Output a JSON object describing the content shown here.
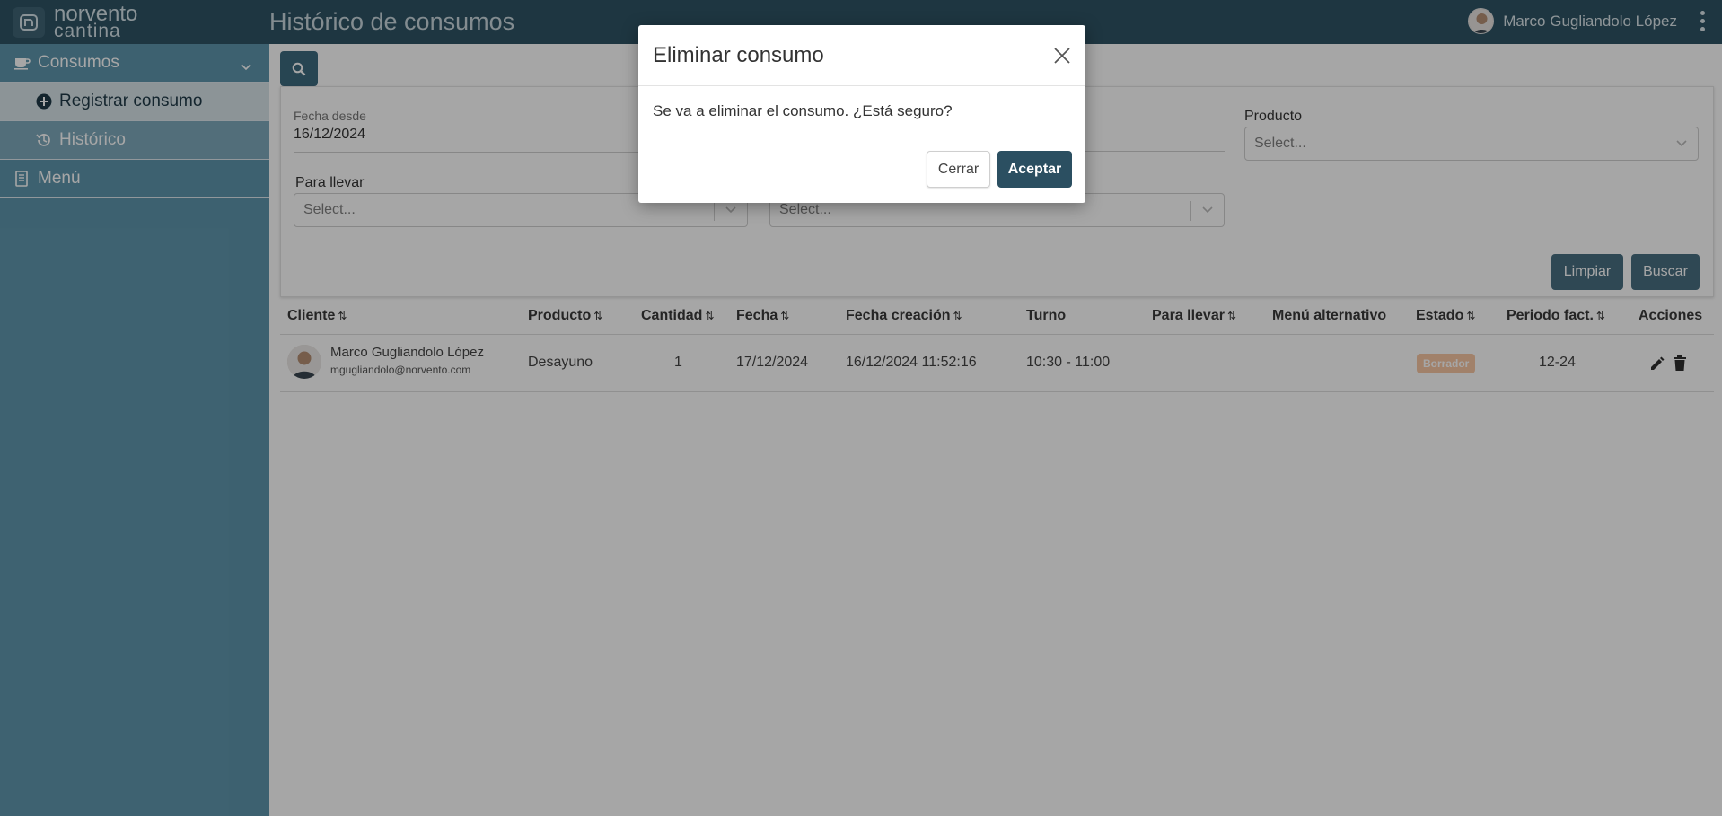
{
  "brand": {
    "line1": "norvento",
    "line2": "cantina"
  },
  "header": {
    "title": "Histórico de consumos",
    "user_name": "Marco Gugliandolo López"
  },
  "sidebar": {
    "items": [
      {
        "label": "Consumos",
        "icon": "coffee-icon"
      },
      {
        "label": "Registrar consumo",
        "icon": "plus-circle-icon"
      },
      {
        "label": "Histórico",
        "icon": "history-icon"
      },
      {
        "label": "Menú",
        "icon": "book-icon"
      }
    ]
  },
  "filters": {
    "fecha_desde_label": "Fecha desde",
    "fecha_desde_value": "16/12/2024",
    "producto_label": "Producto",
    "producto_placeholder": "Select...",
    "para_llevar_label": "Para llevar",
    "para_llevar_placeholder": "Select...",
    "second_select_placeholder": "Select...",
    "clear_label": "Limpiar",
    "search_label": "Buscar"
  },
  "table": {
    "columns": [
      "Cliente",
      "Producto",
      "Cantidad",
      "Fecha",
      "Fecha creación",
      "Turno",
      "Para llevar",
      "Menú alternativo",
      "Estado",
      "Periodo fact.",
      "Acciones"
    ],
    "rows": [
      {
        "client_name": "Marco Gugliandolo López",
        "client_email": "mgugliandolo@norvento.com",
        "producto": "Desayuno",
        "cantidad": "1",
        "fecha": "17/12/2024",
        "fecha_creacion": "16/12/2024 11:52:16",
        "turno": "10:30 - 11:00",
        "para_llevar": "",
        "menu_alternativo": "",
        "estado": "Borrador",
        "periodo": "12-24"
      }
    ]
  },
  "modal": {
    "title": "Eliminar consumo",
    "message": "Se va a eliminar el consumo. ¿Está seguro?",
    "cancel_label": "Cerrar",
    "confirm_label": "Aceptar"
  },
  "colors": {
    "topbar": "#2e5364",
    "sidebar": "#5f96ad",
    "primary_button": "#2b4f61",
    "badge_draft": "#f8c7a4"
  }
}
